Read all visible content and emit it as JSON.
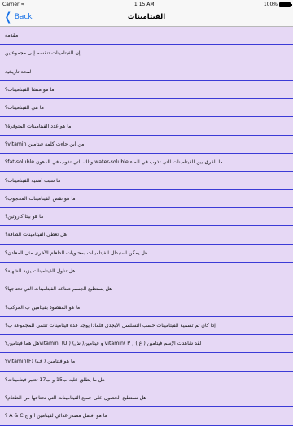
{
  "status": {
    "carrier": "Carrier",
    "time": "1:15 AM",
    "battery_percent": "100%",
    "battery_level": 1.0
  },
  "navbar": {
    "back_label": "Back",
    "title": "الفيتامينات"
  },
  "items": [
    "مقدمه",
    "إن الفيتامينات تنقسم إلى مجموعتين",
    "لمحة تاريخية",
    "ما هو منشأ الفيتامينات؟",
    "ما هي الفيتامينات؟",
    "ما هو عدد الفيتامينات المتوفرة؟",
    "من أين جاءت كلمة فيتامين vitamin؟",
    "ما الفرق بين الفيتامينات التي تذوب في الماء water-soluble وتلك التي تذوب في الدهون fat-soluble؟",
    "ما سبب أهمية الفيتامينات؟",
    "ما هو نقص الفيتامينات المحجوب؟",
    "ما هو بيتا كاروتين؟",
    "هل تعطي الفيتامينات الطاقة؟",
    "هل يمكن استبدال الفيتامينات بمحتويات الطعام الأخرى مثل المعادن؟",
    "هل تناول الفيتامينات يزيد الشهية؟",
    "هل يستطيع الجسم صناعة الفيتامينات التي تحتاجها؟",
    "ما هو المقصود بفيتامين ب المركب؟",
    "إذا كان تم تسمية الفيتامينات حسب التسلسل الأبجدي فلماذا يوجد عدة فيتامينات تنتمي للمجموعة ب؟",
    "لقد شاهدت الإسم فيتامين ( ع ) vitamin( P ) و فيتامين( ش) vitamin. (U )هل هما فيتامين؟",
    "ما هو فيتامين ( ف) vitamin(F)؟",
    "هل ما يطلق عليه ب15 و ب17 تعتبر فيتامينات؟",
    "هل نستطيع الحصول على جميع الفيتامينات التي نحتاجها من الطعام؟",
    "ما هو أفضل مصدر غذائي لفيتامين أ و ج A & C ؟"
  ]
}
